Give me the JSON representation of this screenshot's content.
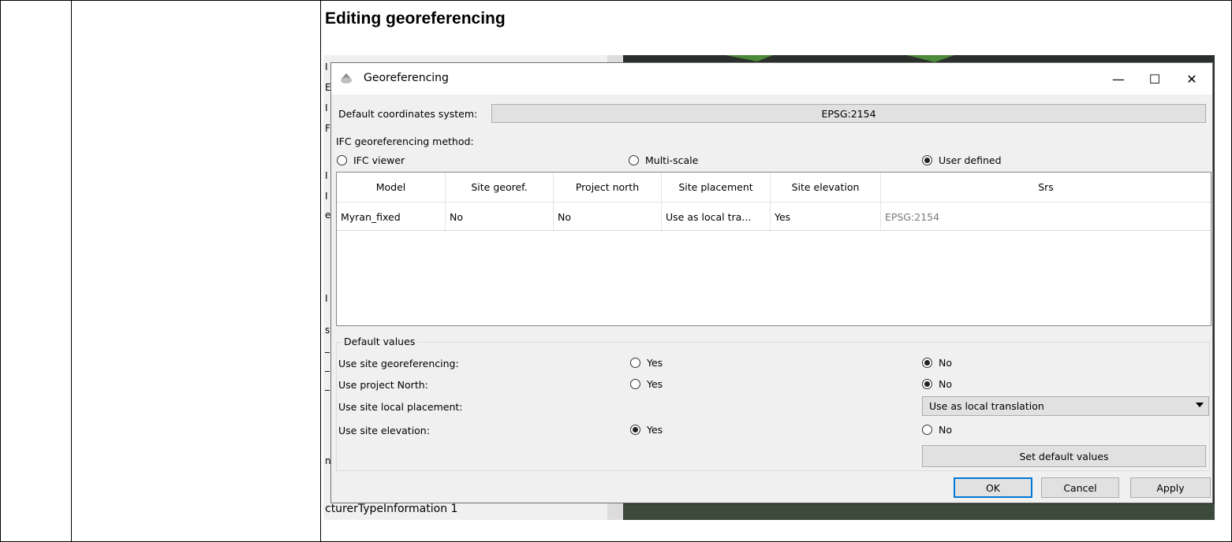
{
  "heading": "Editing georeferencing",
  "background": {
    "bottom_text": "cturerTypeInformation  1",
    "left_fragments": [
      "I",
      "E",
      "I",
      "F",
      "I",
      "I",
      "el",
      "I",
      "st",
      "_",
      "_",
      "_",
      "n"
    ]
  },
  "dialog": {
    "title": "Georeferencing",
    "icons": {
      "app": "globe-icon",
      "minimize": "minimize-icon",
      "maximize": "maximize-icon",
      "close": "close-icon"
    },
    "window_controls": {
      "minimize": "—",
      "maximize": "☐",
      "close": "✕"
    },
    "default_crs_label": "Default coordinates system:",
    "default_crs_value": "EPSG:2154",
    "method_label": "IFC georeferencing method:",
    "methods": [
      {
        "label": "IFC viewer",
        "selected": false
      },
      {
        "label": "Multi-scale",
        "selected": false
      },
      {
        "label": "User defined",
        "selected": true
      }
    ],
    "table": {
      "headers": [
        "Model",
        "Site georef.",
        "Project north",
        "Site placement",
        "Site elevation",
        "Srs"
      ],
      "rows": [
        [
          "Myran_fixed",
          "No",
          "No",
          "Use as local tra...",
          "Yes",
          "EPSG:2154"
        ]
      ]
    },
    "defaults": {
      "group_title": "Default values",
      "site_georef": {
        "label": "Use site georeferencing:",
        "yes": "Yes",
        "no": "No",
        "value": "No"
      },
      "project_north": {
        "label": "Use project North:",
        "yes": "Yes",
        "no": "No",
        "value": "No"
      },
      "local_placement": {
        "label": "Use site local placement:",
        "value": "Use as local translation"
      },
      "site_elevation": {
        "label": "Use site elevation:",
        "yes": "Yes",
        "no": "No",
        "value": "Yes"
      },
      "set_default_button": "Set default values"
    },
    "buttons": {
      "ok": "OK",
      "cancel": "Cancel",
      "apply": "Apply"
    }
  }
}
